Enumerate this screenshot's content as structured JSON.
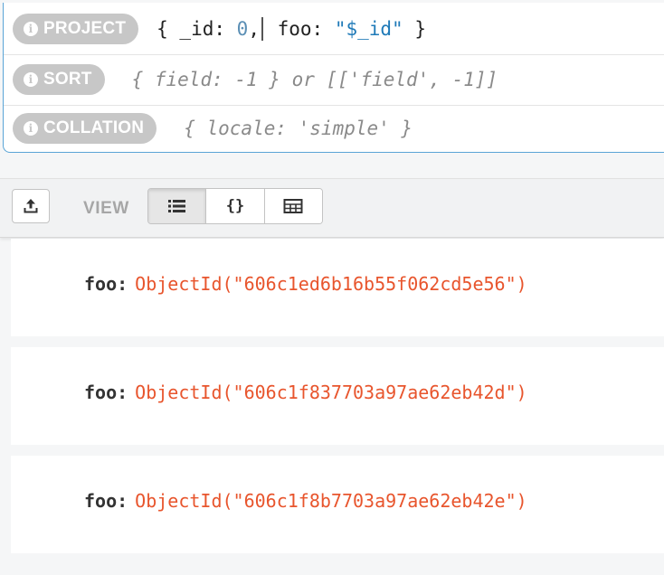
{
  "query": {
    "project": {
      "label": "PROJECT",
      "tokens": {
        "open": "{ _id: ",
        "zero": "0",
        "comma": ",",
        "key2": " foo: ",
        "str": "\"$_id\"",
        "close": " }"
      }
    },
    "sort": {
      "label": "SORT",
      "placeholder": "{ field: -1 } or [['field', -1]]"
    },
    "collation": {
      "label": "COLLATION",
      "placeholder": "{ locale: 'simple' }"
    }
  },
  "toolbar": {
    "view_label": "VIEW",
    "views": [
      {
        "name": "list",
        "icon": "list-icon",
        "active": true
      },
      {
        "name": "json",
        "icon": "braces-icon",
        "glyph": "{}",
        "active": false
      },
      {
        "name": "table",
        "icon": "table-icon",
        "active": false
      }
    ],
    "export_icon": "export-icon"
  },
  "documents": [
    {
      "key": "foo",
      "colon": ":",
      "value": "ObjectId(\"606c1ed6b16b55f062cd5e56\")"
    },
    {
      "key": "foo",
      "colon": ":",
      "value": "ObjectId(\"606c1f837703a97ae62eb42d\")"
    },
    {
      "key": "foo",
      "colon": ":",
      "value": "ObjectId(\"606c1f8b7703a97ae62eb42e\")"
    }
  ],
  "colors": {
    "accent": "#5aa4d6",
    "pill": "#c7c7c7",
    "objectid": "#e8552d",
    "number": "#5b8fb5",
    "string": "#1f7ab8"
  }
}
